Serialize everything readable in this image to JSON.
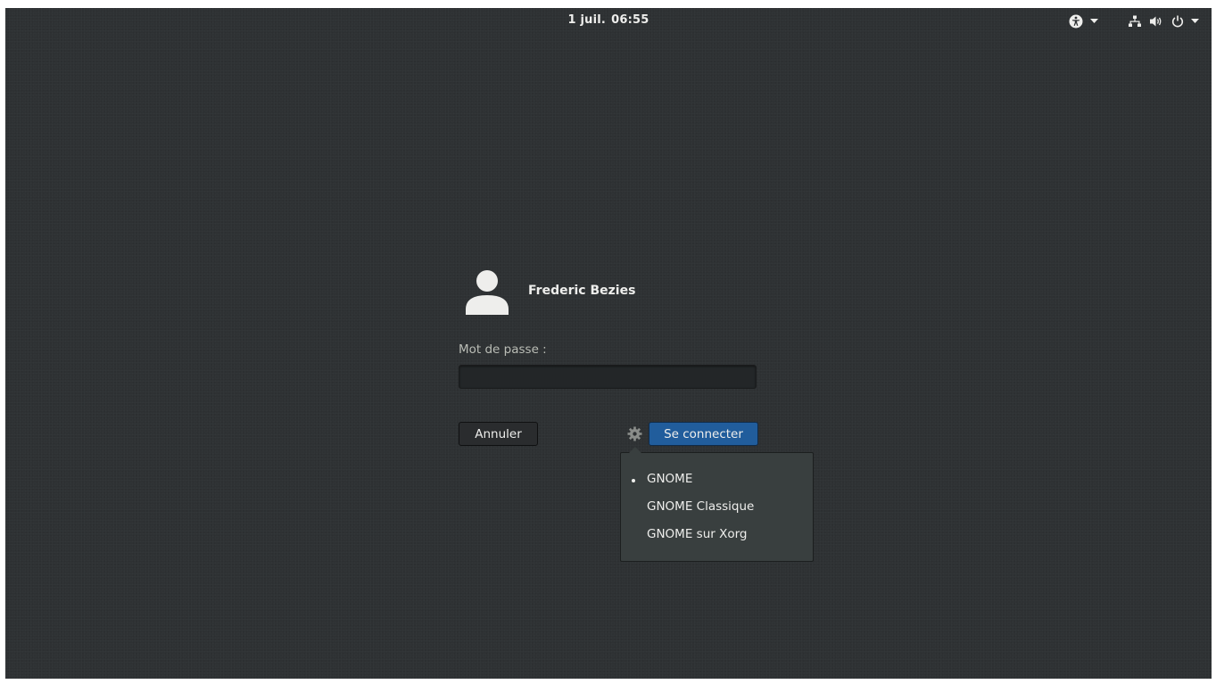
{
  "topbar": {
    "date": "1 juil.",
    "time": "06:55",
    "tray_icons": [
      "accessibility-icon",
      "chevron-down-icon",
      "network-icon",
      "volume-icon",
      "power-icon",
      "chevron-down-icon"
    ]
  },
  "login": {
    "user_name": "Frederic Bezies",
    "password_label": "Mot de passe :",
    "password_value": "",
    "cancel_label": "Annuler",
    "login_label": "Se connecter",
    "settings_icon": "gear-icon"
  },
  "session_menu": {
    "selected": "GNOME",
    "items": [
      "GNOME",
      "GNOME Classique",
      "GNOME sur Xorg"
    ]
  },
  "colors": {
    "background": "#2e3133",
    "accent": "#215d9c",
    "text": "#eeeeec"
  }
}
